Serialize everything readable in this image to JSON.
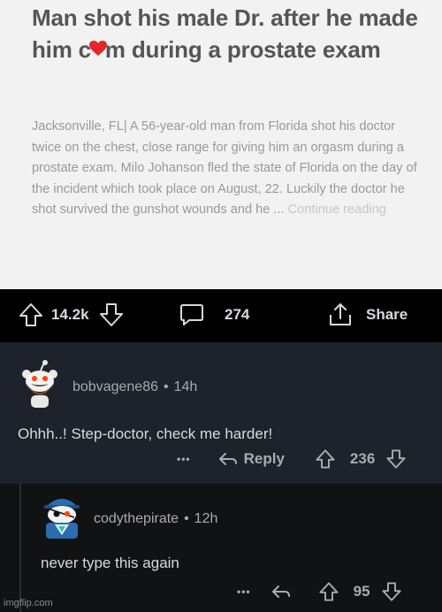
{
  "article": {
    "title_before": "Man shot his male Dr. after he made him c",
    "title_after": "m during a prostate exam",
    "body": "Jacksonville, FL| A 56-year-old man from Florida shot his doctor twice on the chest, close range for giving him an orgasm during a prostate exam. Milo Johanson fled the state of Florida on the day of the incident which took place on August, 22. Luckily the doctor he shot survived the gunshot wounds and he ... ",
    "continue_label": "Continue reading"
  },
  "post_actions": {
    "upvotes": "14.2k",
    "comments": "274",
    "share_label": "Share"
  },
  "comments": [
    {
      "username": "bobvagene86",
      "separator": "•",
      "age": "14h",
      "text": "Ohhh..! Step-doctor, check me harder!",
      "more": "•••",
      "reply_label": "Reply",
      "score": "236"
    },
    {
      "username": "codythepirate",
      "separator": "•",
      "age": "12h",
      "text": "never type this again",
      "more": "•••",
      "score": "95"
    }
  ],
  "watermark": "imgflip.com",
  "colors": {
    "article_bg": "#f2f2f2",
    "title": "#555555",
    "body_text": "#999999",
    "comment1_bg": "#1d222b",
    "comment2_bg": "#111214",
    "heart": "#e5262b"
  }
}
